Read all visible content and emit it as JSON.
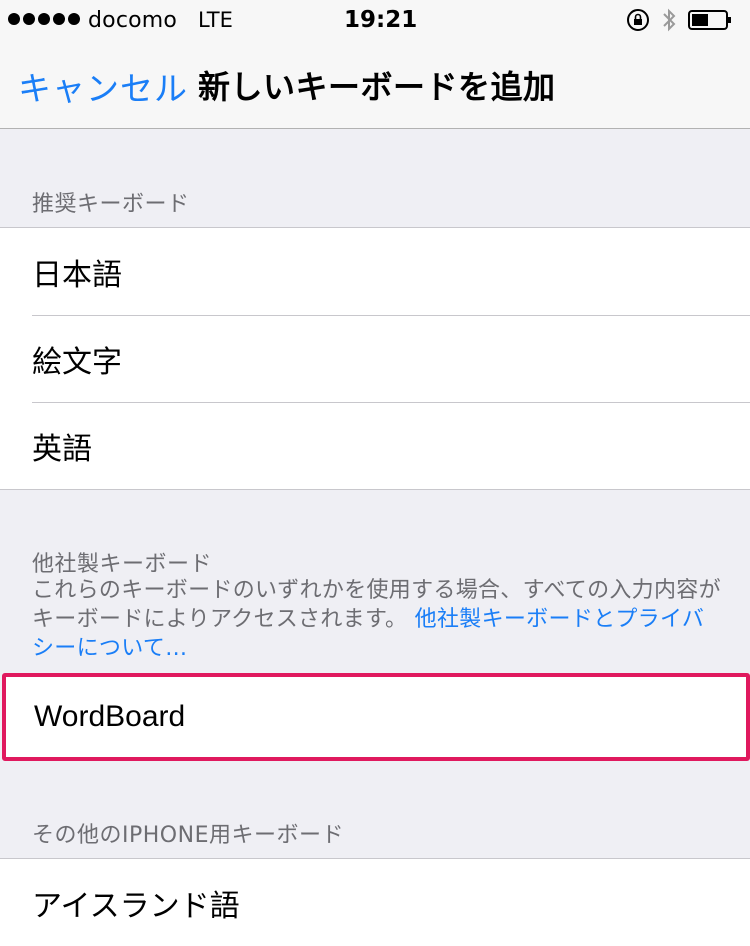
{
  "status_bar": {
    "carrier": "docomo",
    "network": "LTE",
    "time": "19:21"
  },
  "nav": {
    "cancel_label": "キャンセル",
    "title": "新しいキーボードを追加"
  },
  "sections": {
    "suggested": {
      "header": "推奨キーボード",
      "items": [
        "日本語",
        "絵文字",
        "英語"
      ]
    },
    "third_party": {
      "header": "他社製キーボード",
      "description": "これらのキーボードのいずれかを使用する場合、すべての入力内容がキーボードによりアクセスされます。",
      "link": "他社製キーボードとプライバシーについて…",
      "items": [
        "WordBoard"
      ]
    },
    "other_iphone": {
      "header": "その他のIPHONE用キーボード",
      "items": [
        "アイスランド語"
      ]
    }
  },
  "colors": {
    "accent": "#1a7ef7",
    "highlight": "#e0195e",
    "background": "#efeff4"
  },
  "icons": {
    "lock": "rotation-lock-icon",
    "bluetooth": "bluetooth-icon",
    "battery": "battery-icon"
  }
}
